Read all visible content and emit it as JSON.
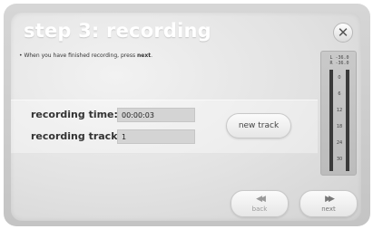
{
  "dialog": {
    "title": "step 3: recording",
    "close_symbol": "✕",
    "instruction_prefix": "• When you have finished recording, press ",
    "instruction_bold": "next",
    "instruction_suffix": "."
  },
  "fields": {
    "recording_time_label": "recording time:",
    "recording_time_value": "00:00:03",
    "recording_track_label": "recording track:",
    "recording_track_value": "1"
  },
  "buttons": {
    "new_track": "new track",
    "back": "back",
    "back_icon": "◀◀",
    "next": "next",
    "next_icon": "▶▶"
  },
  "meter": {
    "left_label": "L  -36.0",
    "right_label": "R  -36.0",
    "scale": [
      "0",
      "6",
      "12",
      "18",
      "24",
      "30"
    ]
  },
  "colors": {
    "panel_bg": "#e2e2e2",
    "title_text": "#ffffff",
    "field_bg": "#d4d4d4",
    "meter_bar": "#3a3a3a"
  }
}
